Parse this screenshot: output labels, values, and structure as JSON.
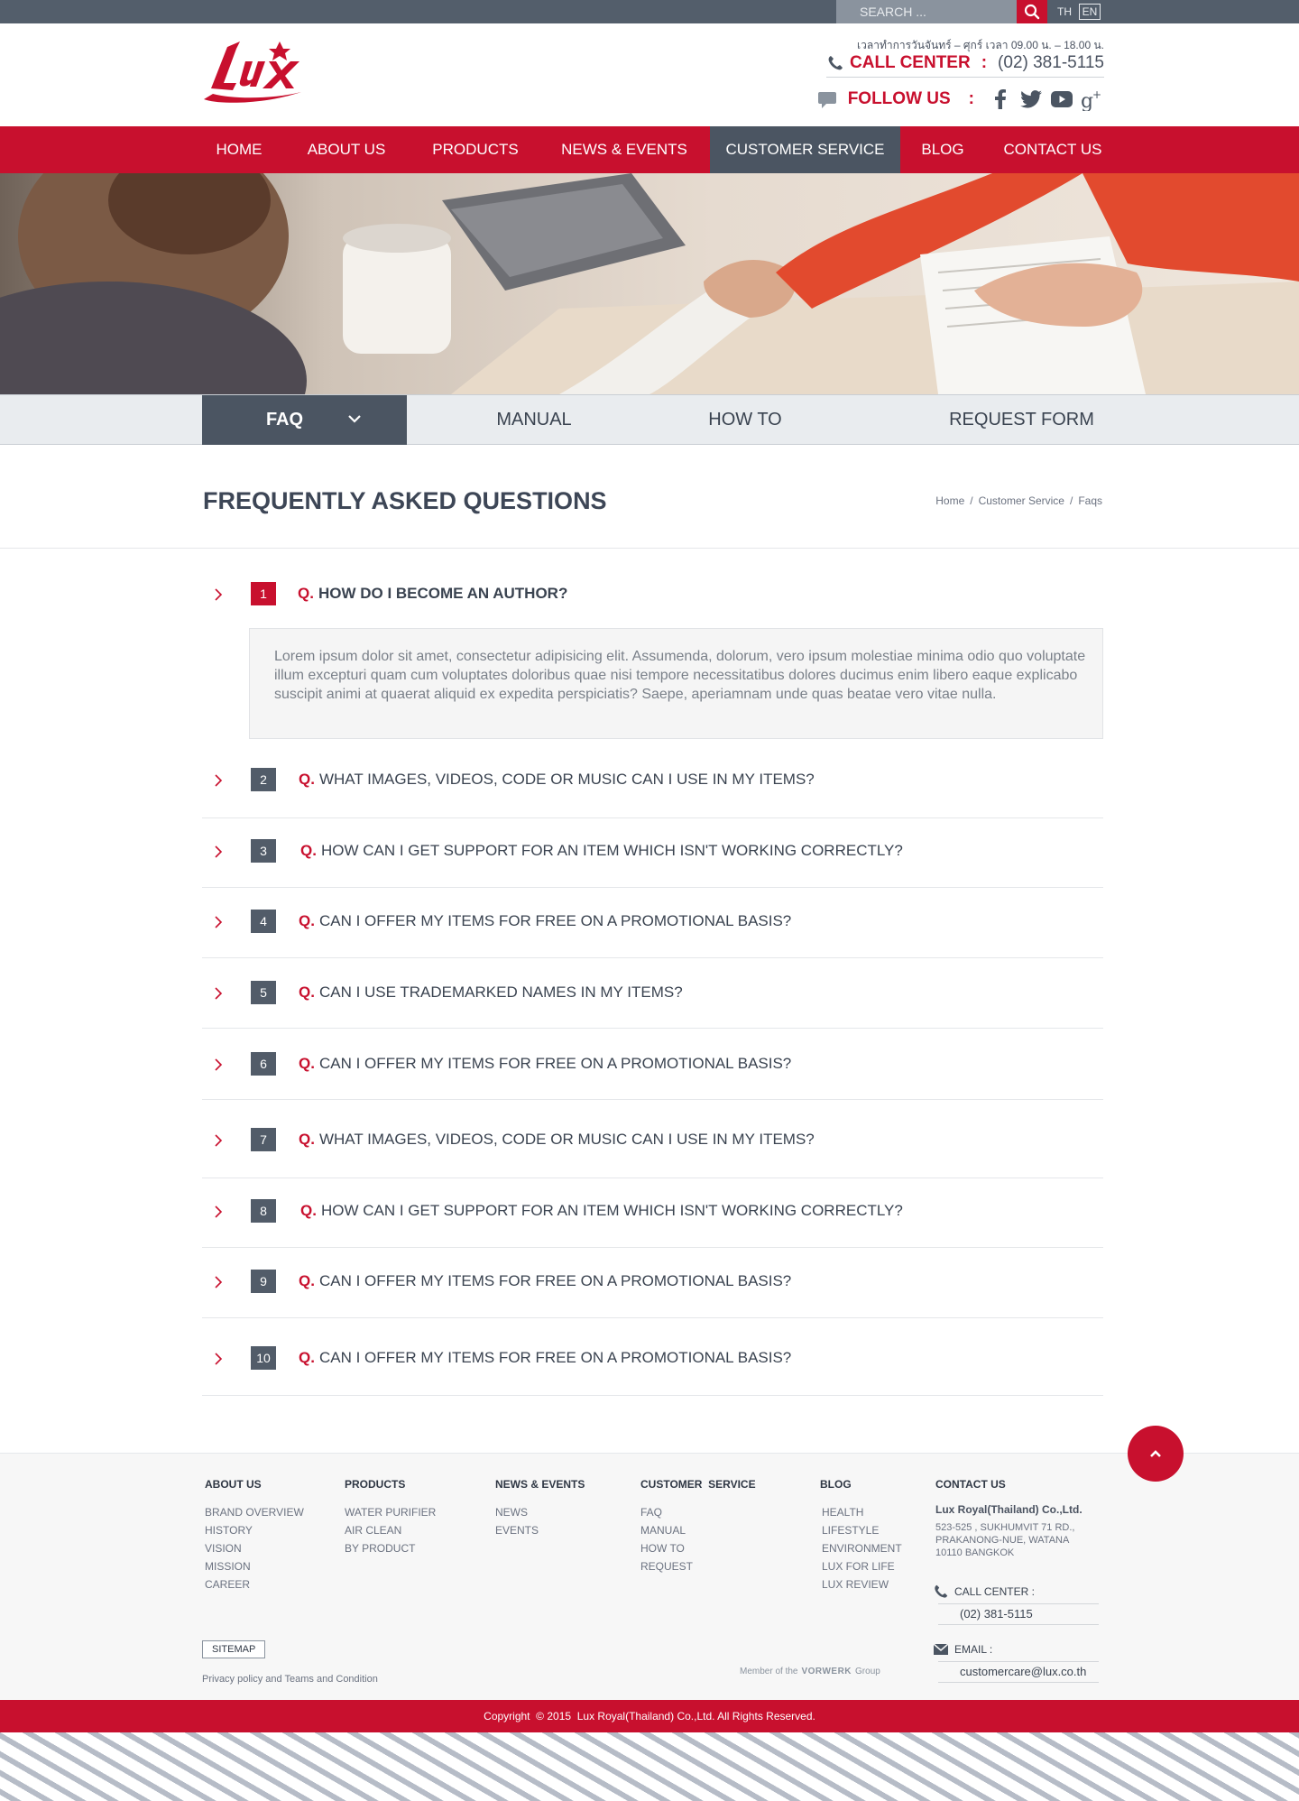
{
  "topbar": {
    "search_placeholder": "SEARCH ...",
    "lang_th": "TH",
    "lang_en": "EN"
  },
  "header": {
    "logo_text": "LUX",
    "hours": "เวลาทำการวันจันทร์ – ศุกร์ เวลา 09.00 น. – 18.00 น.",
    "call_center_label": "CALL CENTER",
    "call_center_colon": ":",
    "call_center_phone": "(02) 381-5115",
    "follow_label": "FOLLOW US",
    "follow_colon": ":",
    "social": [
      "facebook-icon",
      "twitter-icon",
      "youtube-icon",
      "google-plus-icon"
    ]
  },
  "nav": {
    "items": [
      {
        "label": "HOME"
      },
      {
        "label": "ABOUT US"
      },
      {
        "label": "PRODUCTS"
      },
      {
        "label": "NEWS & EVENTS"
      },
      {
        "label": "CUSTOMER SERVICE"
      },
      {
        "label": "BLOG"
      },
      {
        "label": "CONTACT US"
      }
    ],
    "active": "CUSTOMER SERVICE"
  },
  "subnav": {
    "items": [
      {
        "label": "FAQ"
      },
      {
        "label": "MANUAL"
      },
      {
        "label": "HOW TO"
      },
      {
        "label": "REQUEST FORM"
      }
    ],
    "active": "FAQ"
  },
  "page": {
    "title": "FREQUENTLY ASKED QUESTIONS",
    "breadcrumb": [
      "Home",
      "/",
      "Customer Service",
      "/",
      "Faqs"
    ]
  },
  "faq": {
    "q_prefix": "Q.",
    "answer_1": "Lorem ipsum dolor sit amet, consectetur adipisicing elit. Assumenda, dolorum, vero ipsum molestiae minima odio quo voluptate illum excepturi quam cum voluptates doloribus quae nisi tempore necessitatibus dolores ducimus enim libero eaque explicabo suscipit animi at quaerat aliquid ex expedita perspiciatis? Saepe, aperiamnam unde quas beatae vero vitae nulla.",
    "items": [
      {
        "num": "1",
        "question": "HOW DO I BECOME AN AUTHOR?"
      },
      {
        "num": "2",
        "question": "WHAT IMAGES, VIDEOS, CODE OR MUSIC CAN I USE IN MY ITEMS?"
      },
      {
        "num": "3",
        "question": "HOW CAN I GET SUPPORT FOR AN ITEM WHICH ISN'T WORKING CORRECTLY?"
      },
      {
        "num": "4",
        "question": "CAN I OFFER MY ITEMS FOR FREE ON A PROMOTIONAL BASIS?"
      },
      {
        "num": "5",
        "question": "CAN I USE TRADEMARKED NAMES IN MY ITEMS?"
      },
      {
        "num": "6",
        "question": "CAN I OFFER MY ITEMS FOR FREE ON A PROMOTIONAL BASIS?"
      },
      {
        "num": "7",
        "question": "WHAT IMAGES, VIDEOS, CODE OR MUSIC CAN I USE IN MY ITEMS?"
      },
      {
        "num": "8",
        "question": "HOW CAN I GET SUPPORT FOR AN ITEM WHICH ISN'T WORKING CORRECTLY?"
      },
      {
        "num": "9",
        "question": "CAN I OFFER MY ITEMS FOR FREE ON A PROMOTIONAL BASIS?"
      },
      {
        "num": "10",
        "question": "CAN I OFFER MY ITEMS FOR FREE ON A PROMOTIONAL BASIS?"
      }
    ]
  },
  "footer": {
    "about": {
      "head": "ABOUT US",
      "links": [
        "BRAND OVERVIEW",
        "HISTORY",
        "VISION",
        "MISSION",
        "CAREER"
      ]
    },
    "products": {
      "head": "PRODUCTS",
      "links": [
        "WATER PURIFIER",
        "AIR CLEAN",
        "BY PRODUCT"
      ]
    },
    "news": {
      "head": "NEWS & EVENTS",
      "links": [
        "NEWS",
        "EVENTS"
      ]
    },
    "service": {
      "head": "CUSTOMER  SERVICE",
      "links": [
        "FAQ",
        "MANUAL",
        "HOW TO",
        "REQUEST"
      ]
    },
    "blog": {
      "head": "BLOG",
      "links": [
        "HEALTH",
        "LIFESTYLE",
        "ENVIRONMENT",
        "LUX FOR LIFE",
        "LUX REVIEW"
      ]
    },
    "contact": {
      "head": "CONTACT US",
      "company": "Lux Royal(Thailand) Co.,Ltd.",
      "address": [
        "523-525 , SUKHUMVIT 71 RD.,",
        "PRAKANONG-NUE, WATANA",
        "10110 BANGKOK"
      ],
      "call_label": "CALL CENTER :",
      "call_value": "(02) 381-5115",
      "email_label": "EMAIL :",
      "email_value": "customercare@lux.co.th"
    },
    "sitemap": "SITEMAP",
    "privacy": "Privacy policy and Teams and Condition",
    "member_prefix": "Member of the",
    "member_brand": "VORWERK",
    "member_suffix": "Group",
    "copyright": "Copyright  © 2015  Lux Royal(Thailand) Co.,Ltd. All Rights Reserved."
  },
  "colors": {
    "brand_red": "#c8102e",
    "slate": "#4b5562",
    "topbar": "#535e6b"
  }
}
